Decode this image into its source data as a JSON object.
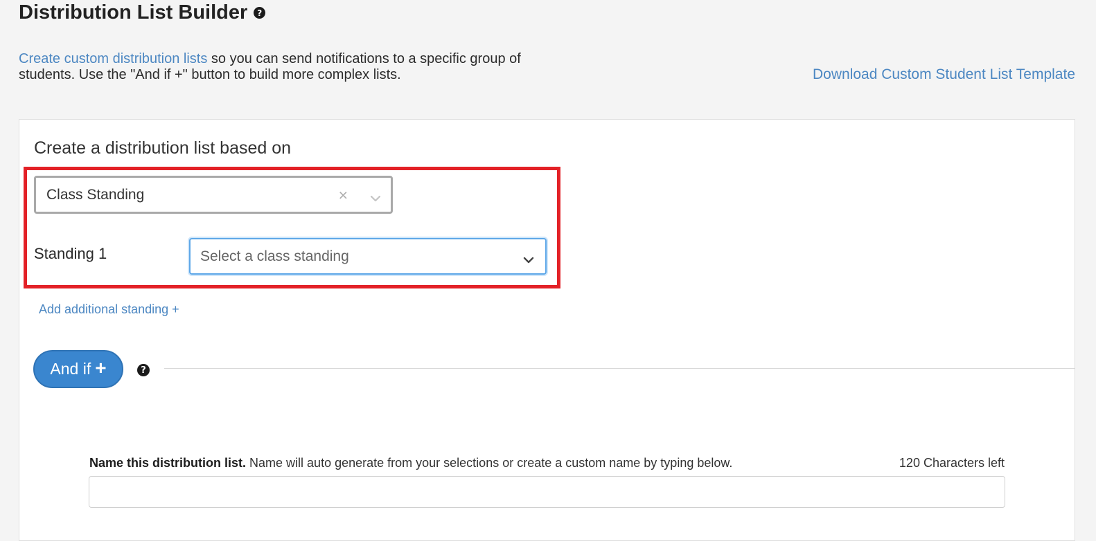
{
  "header": {
    "title": "Distribution List Builder",
    "help_icon": "question-circle-icon"
  },
  "intro": {
    "link_text": "Create custom distribution lists",
    "text": " so you can send notifications to a specific group of students. Use the \"And if +\" button to build more complex lists."
  },
  "download_link": "Download Custom Student List Template",
  "builder": {
    "heading": "Create a distribution list based on",
    "criteria_select": {
      "value": "Class Standing",
      "clear_icon": "close-icon",
      "dropdown_icon": "chevron-down-icon"
    },
    "standing_label": "Standing 1",
    "standing_select": {
      "placeholder": "Select a class standing",
      "dropdown_icon": "chevron-down-icon"
    },
    "add_standing_link": "Add additional standing +",
    "and_if_button": {
      "label": "And if",
      "plus": "+"
    },
    "highlight_color": "#e32127",
    "accent_color": "#3a86cf"
  },
  "name_section": {
    "label_bold": "Name this distribution list.",
    "label_text": " Name will auto generate from your selections or create a custom name by typing below.",
    "chars_left": "120 Characters left",
    "input_value": ""
  }
}
